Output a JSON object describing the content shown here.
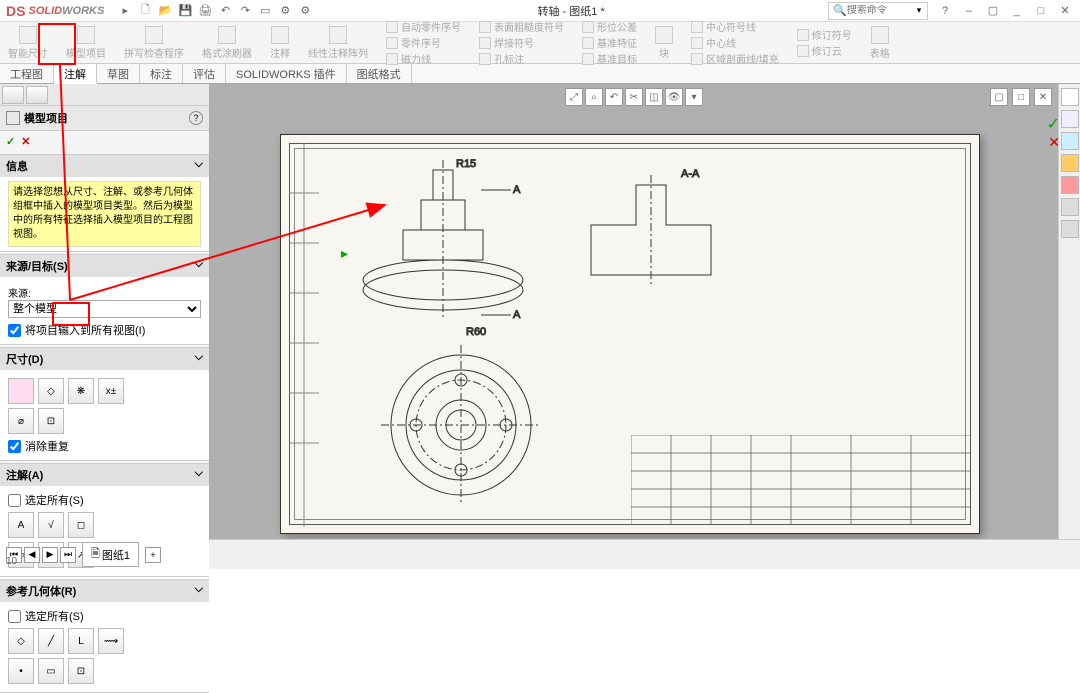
{
  "app": {
    "name_prefix": "S",
    "name_mid": "SOLID",
    "name_suffix": "WORKS"
  },
  "title": "转轴 - 图纸1 *",
  "search": {
    "placeholder": "搜索命令"
  },
  "ribbon": [
    {
      "label": "智能尺寸"
    },
    {
      "label": "模型项目"
    },
    {
      "label": "拼写检查程序"
    },
    {
      "label": "格式涂刷器"
    },
    {
      "label": "注释"
    },
    {
      "label": "线性注释阵列"
    },
    {
      "label": "自动零件序号"
    },
    {
      "label": "零件序号"
    },
    {
      "label": "磁力线"
    },
    {
      "label": "表面粗糙度符号"
    },
    {
      "label": "焊接符号"
    },
    {
      "label": "孔标注"
    },
    {
      "label": "形位公差"
    },
    {
      "label": "基准特征"
    },
    {
      "label": "基准目标"
    },
    {
      "label": "块"
    },
    {
      "label": "中心符号线"
    },
    {
      "label": "中心线"
    },
    {
      "label": "区域剖面线/填充"
    },
    {
      "label": "修订符号"
    },
    {
      "label": "修订云"
    },
    {
      "label": "表格"
    }
  ],
  "tabs": [
    "工程图",
    "注解",
    "草图",
    "标注",
    "评估",
    "SOLIDWORKS 插件",
    "图纸格式"
  ],
  "active_tab": "注解",
  "panel": {
    "title": "模型项目",
    "info_head": "信息",
    "info_text": "请选择您想从尺寸、注解、或参考几何体组框中插入的模型项目类型。然后为模型中的所有特征选择插入模型项目的工程图视图。",
    "source_head": "来源/目标(S)",
    "source_label": "来源:",
    "source_value": "整个模型",
    "import_all": "将项目输入到所有视图(I)",
    "dim_head": "尺寸(D)",
    "elim_dup": "消除重复",
    "annot_head": "注解(A)",
    "annot_select_all": "选定所有(S)",
    "ref_head": "参考几何体(R)",
    "ref_select_all": "选定所有(S)"
  },
  "drawing": {
    "section_label": "A-A",
    "section_arrow_a": "A",
    "section_arrow_b": "A",
    "dims": {
      "d1": "R15",
      "d2": "R60"
    }
  },
  "sheet_tab": "图纸1",
  "zoom": "10"
}
